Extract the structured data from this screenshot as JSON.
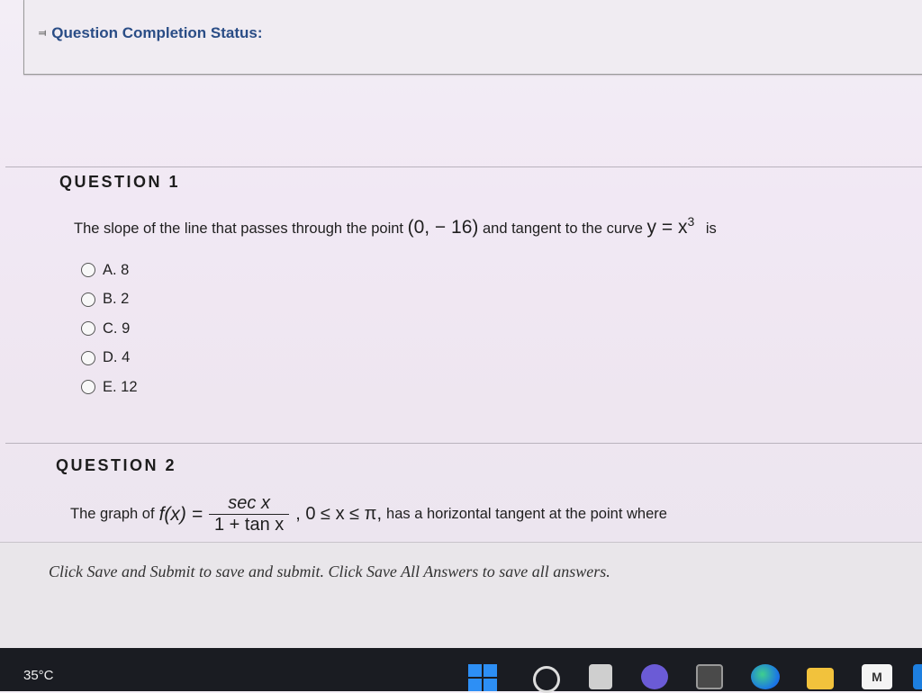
{
  "status": {
    "title": "Question Completion Status:"
  },
  "question1": {
    "heading": "QUESTION 1",
    "text_before": "The slope of the line that passes through the point",
    "point": "(0, − 16)",
    "text_middle": "and tangent to the curve",
    "curve": "y = x",
    "exponent": "3",
    "text_end": "is",
    "choices": [
      "A. 8",
      "B. 2",
      "C. 9",
      "D. 4",
      "E. 12"
    ]
  },
  "question2": {
    "heading": "QUESTION 2",
    "text_before": "The graph of",
    "function_lhs": "f(x) =",
    "numerator": "sec x",
    "denominator": "1 + tan x",
    "domain": ", 0 ≤ x ≤ π,",
    "text_end": "has a horizontal tangent at the point where"
  },
  "footer": {
    "text": "Click Save and Submit to save and submit. Click Save All Answers to save all answers."
  },
  "taskbar": {
    "weather": "35°C",
    "mathway_label": "M"
  }
}
